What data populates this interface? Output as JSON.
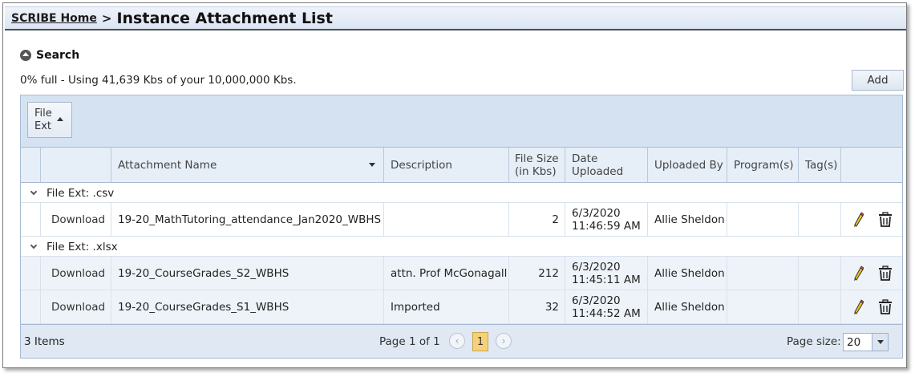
{
  "breadcrumb": {
    "home_label": "SCRIBE Home",
    "separator": ">",
    "title": "Instance Attachment List"
  },
  "search": {
    "label": "Search"
  },
  "quota_text": "0% full - Using 41,639 Kbs of your 10,000,000 Kbs.",
  "toolbar": {
    "add_label": "Add"
  },
  "group_panel": {
    "chip_line1": "File",
    "chip_line2": "Ext"
  },
  "columns": {
    "attachment_name": "Attachment Name",
    "description": "Description",
    "file_size_1": "File Size",
    "file_size_2": "(in Kbs)",
    "date_1": "Date",
    "date_2": "Uploaded",
    "uploaded_by": "Uploaded By",
    "programs": "Program(s)",
    "tags": "Tag(s)"
  },
  "groups": [
    {
      "label": "File Ext: .csv"
    },
    {
      "label": "File Ext: .xlsx"
    }
  ],
  "rows": [
    {
      "action": "Download",
      "name": "19-20_MathTutoring_attendance_Jan2020_WBHS",
      "description": "",
      "size": "2",
      "date": "6/3/2020",
      "time": "11:46:59 AM",
      "uploaded_by": "Allie Sheldon",
      "programs": "",
      "tags": ""
    },
    {
      "action": "Download",
      "name": "19-20_CourseGrades_S2_WBHS",
      "description": "attn. Prof McGonagall",
      "size": "212",
      "date": "6/3/2020",
      "time": "11:45:11 AM",
      "uploaded_by": "Allie Sheldon",
      "programs": "",
      "tags": ""
    },
    {
      "action": "Download",
      "name": "19-20_CourseGrades_S1_WBHS",
      "description": "Imported",
      "size": "32",
      "date": "6/3/2020",
      "time": "11:44:52 AM",
      "uploaded_by": "Allie Sheldon",
      "programs": "",
      "tags": ""
    }
  ],
  "footer": {
    "items_count": "3 Items",
    "pager_text": "Page 1 of 1",
    "current_page": "1",
    "page_size_label": "Page size:",
    "page_size_value": "20"
  },
  "icons": {
    "edit": "pencil-icon",
    "delete": "trash-icon",
    "search_toggle": "circle-chevron-up-icon"
  },
  "colors": {
    "header_bg": "#e6eef8",
    "group_panel_bg": "#d5e2f1",
    "alt_row_bg": "#eef3fa",
    "current_page": "#f5d27a"
  }
}
